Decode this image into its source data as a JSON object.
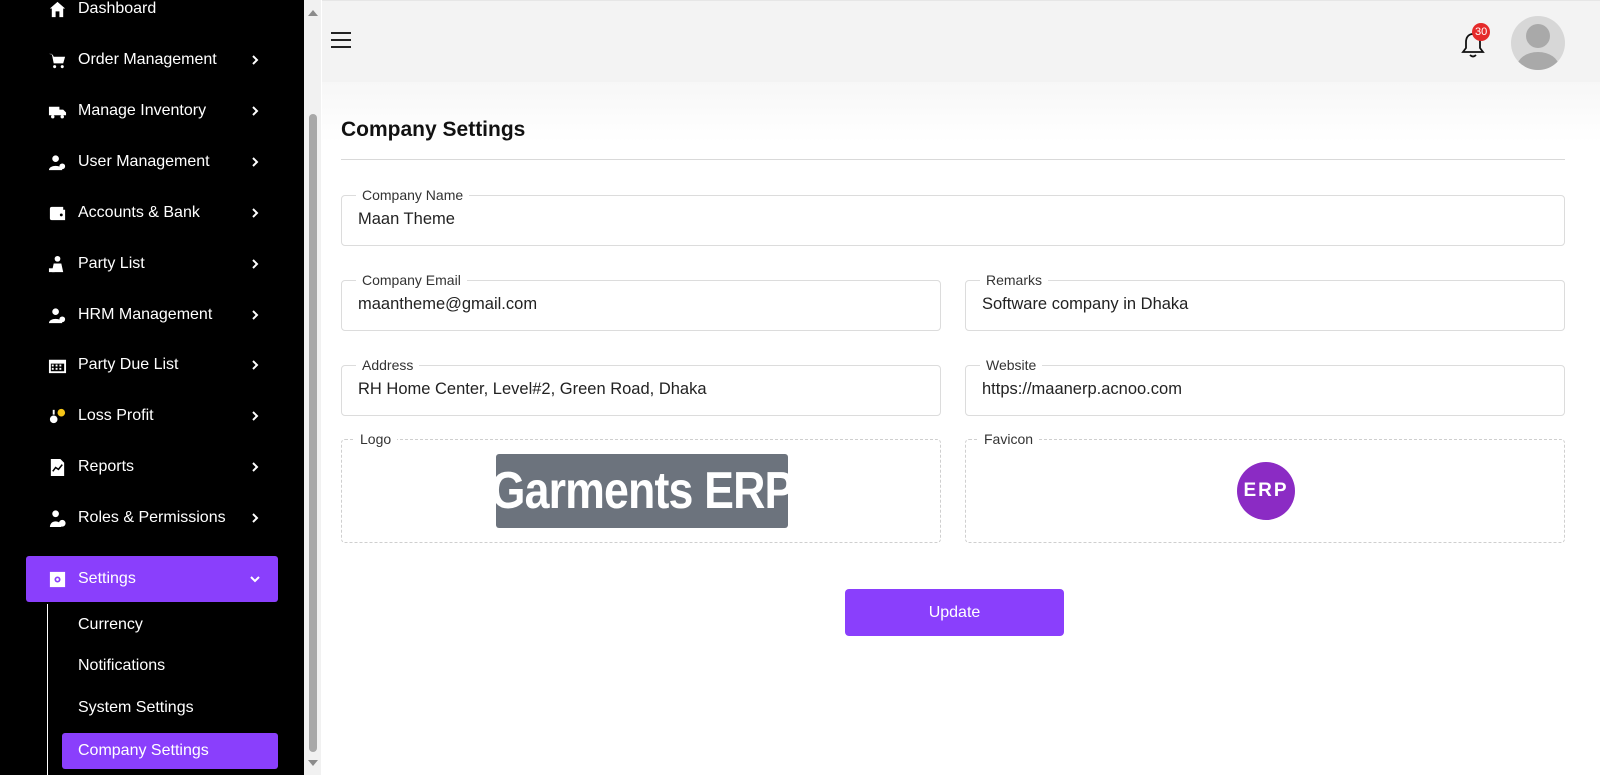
{
  "sidebar": {
    "items": [
      {
        "label": "Dashboard",
        "icon": "home-icon"
      },
      {
        "label": "Order Management",
        "icon": "cart-icon"
      },
      {
        "label": "Manage Inventory",
        "icon": "truck-icon"
      },
      {
        "label": "User Management",
        "icon": "users-icon"
      },
      {
        "label": "Accounts & Bank",
        "icon": "wallet-icon"
      },
      {
        "label": "Party List",
        "icon": "party-icon"
      },
      {
        "label": "HRM Management",
        "icon": "hrm-icon"
      },
      {
        "label": "Party Due List",
        "icon": "calendar-icon"
      },
      {
        "label": "Loss Profit",
        "icon": "coins-icon"
      },
      {
        "label": "Reports",
        "icon": "report-icon"
      },
      {
        "label": "Roles & Permissions",
        "icon": "roles-icon"
      },
      {
        "label": "Settings",
        "icon": "settings-icon"
      }
    ],
    "sub_items": [
      {
        "label": "Currency"
      },
      {
        "label": "Notifications"
      },
      {
        "label": "System Settings"
      },
      {
        "label": "Company Settings"
      }
    ]
  },
  "header": {
    "notification_count": "30"
  },
  "page": {
    "title": "Company Settings"
  },
  "form": {
    "company_name": {
      "label": "Company Name",
      "value": "Maan Theme"
    },
    "company_email": {
      "label": "Company Email",
      "value": "maantheme@gmail.com"
    },
    "remarks": {
      "label": "Remarks",
      "value": "Software company in Dhaka"
    },
    "address": {
      "label": "Address",
      "value": "RH Home Center, Level#2, Green Road, Dhaka"
    },
    "website": {
      "label": "Website",
      "value": "https://maanerp.acnoo.com"
    },
    "logo": {
      "label": "Logo",
      "image_text": "Garments ERP"
    },
    "favicon": {
      "label": "Favicon",
      "image_text": "ERP"
    },
    "update_label": "Update"
  },
  "colors": {
    "accent": "#8a3ffc",
    "sidebar_bg": "#000000",
    "badge": "#e52a2a",
    "favicon_bg": "#8b2bc4"
  }
}
